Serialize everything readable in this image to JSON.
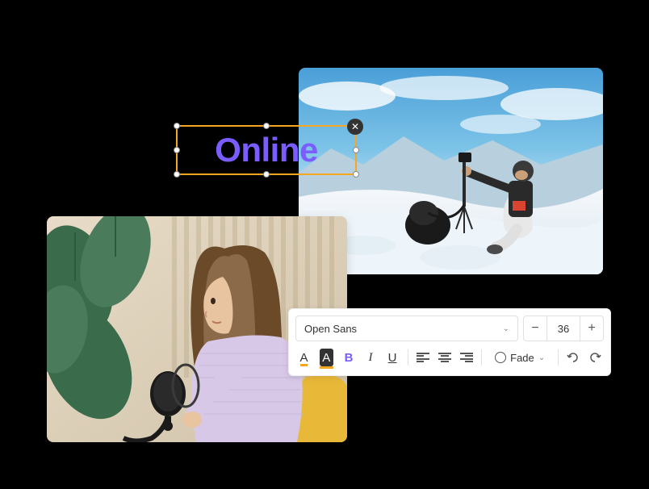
{
  "textSelection": {
    "text": "Online",
    "closeLabel": "✕"
  },
  "toolbar": {
    "fontName": "Open Sans",
    "fontSize": "36",
    "minusLabel": "−",
    "plusLabel": "+",
    "textColorLetter": "A",
    "bgColorLetter": "A",
    "boldLetter": "B",
    "italicLetter": "I",
    "underlineLetter": "U",
    "fadeLabel": "Fade"
  }
}
